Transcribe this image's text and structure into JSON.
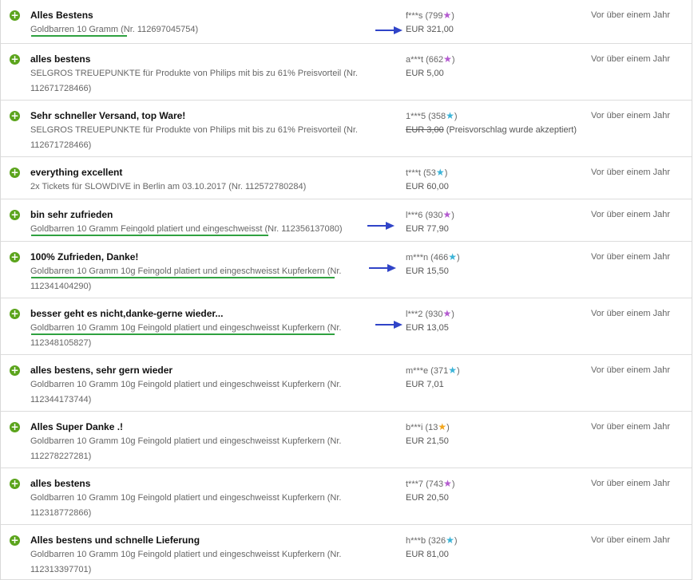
{
  "colors": {
    "plus_green": "#5ba41c",
    "underline_green": "#2fa140",
    "arrow_blue": "#3044c8",
    "star_purple": "#b45bd0",
    "star_teal": "#3bb4d8",
    "star_orange": "#f3a61c"
  },
  "rows": [
    {
      "icon": "plus-circle-icon",
      "comment": "Alles Bestens",
      "item": "Goldbarren 10 Gramm (Nr. 112697045754)",
      "rater": "f***s (799",
      "star_color": "purple",
      "price": "EUR 321,00",
      "date": "Vor über einem Jahr"
    },
    {
      "icon": "plus-circle-icon",
      "comment": "alles bestens",
      "item": "SELGROS TREUEPUNKTE für Produkte von Philips mit bis zu 61% Preisvorteil (Nr. 112671728466)",
      "rater": "a***t (662",
      "star_color": "purple",
      "price": "EUR 5,00",
      "date": "Vor über einem Jahr"
    },
    {
      "icon": "plus-circle-icon",
      "comment": "Sehr schneller Versand, top Ware!",
      "item": "SELGROS TREUEPUNKTE für Produkte von Philips mit bis zu 61% Preisvorteil (Nr. 112671728466)",
      "rater": "1***5 (358",
      "star_color": "teal",
      "price_struck": "EUR 3,00",
      "price_note": "(Preisvorschlag wurde akzeptiert)",
      "date": "Vor über einem Jahr"
    },
    {
      "icon": "plus-circle-icon",
      "comment": "everything excellent",
      "item": "2x Tickets für SLOWDIVE in Berlin am 03.10.2017 (Nr. 112572780284)",
      "rater": "t***t (53",
      "star_color": "teal",
      "price": "EUR 60,00",
      "date": "Vor über einem Jahr"
    },
    {
      "icon": "plus-circle-icon",
      "comment": "bin sehr zufrieden",
      "item": "Goldbarren 10 Gramm Feingold platiert und eingeschweisst (Nr. 112356137080)",
      "rater": "l***6 (930",
      "star_color": "purple",
      "price": "EUR 77,90",
      "date": "Vor über einem Jahr"
    },
    {
      "icon": "plus-circle-icon",
      "comment": "100% Zufrieden, Danke!",
      "item": "Goldbarren 10 Gramm 10g Feingold platiert und eingeschweisst Kupferkern (Nr. 112341404290)",
      "rater": "m***n (466",
      "star_color": "teal",
      "price": "EUR 15,50",
      "date": "Vor über einem Jahr"
    },
    {
      "icon": "plus-circle-icon",
      "comment": "besser geht es nicht,danke-gerne wieder...",
      "item": "Goldbarren 10 Gramm 10g Feingold platiert und eingeschweisst Kupferkern (Nr. 112348105827)",
      "rater": "l***2 (930",
      "star_color": "purple",
      "price": "EUR 13,05",
      "date": "Vor über einem Jahr"
    },
    {
      "icon": "plus-circle-icon",
      "comment": "alles bestens, sehr gern wieder",
      "item": "Goldbarren 10 Gramm 10g Feingold platiert und eingeschweisst Kupferkern (Nr. 112344173744)",
      "rater": "m***e (371",
      "star_color": "teal",
      "price": "EUR 7,01",
      "date": "Vor über einem Jahr"
    },
    {
      "icon": "plus-circle-icon",
      "comment": "Alles Super Danke .!",
      "item": "Goldbarren 10 Gramm 10g Feingold platiert und eingeschweisst Kupferkern (Nr. 112278227281)",
      "rater": "b***i (13",
      "star_color": "orange",
      "price": "EUR 21,50",
      "date": "Vor über einem Jahr"
    },
    {
      "icon": "plus-circle-icon",
      "comment": "alles bestens",
      "item": "Goldbarren 10 Gramm 10g Feingold platiert und eingeschweisst Kupferkern (Nr. 112318772866)",
      "rater": "t***7 (743",
      "star_color": "purple",
      "price": "EUR 20,50",
      "date": "Vor über einem Jahr"
    },
    {
      "icon": "plus-circle-icon",
      "comment": "Alles bestens und schnelle Lieferung",
      "item": "Goldbarren 10 Gramm 10g Feingold platiert und eingeschweisst Kupferkern (Nr. 112313397701)",
      "rater": "h***b (326",
      "star_color": "teal",
      "price": "EUR 81,00",
      "date": "Vor über einem Jahr"
    }
  ],
  "star_glyph": "★",
  "rater_close": ")"
}
